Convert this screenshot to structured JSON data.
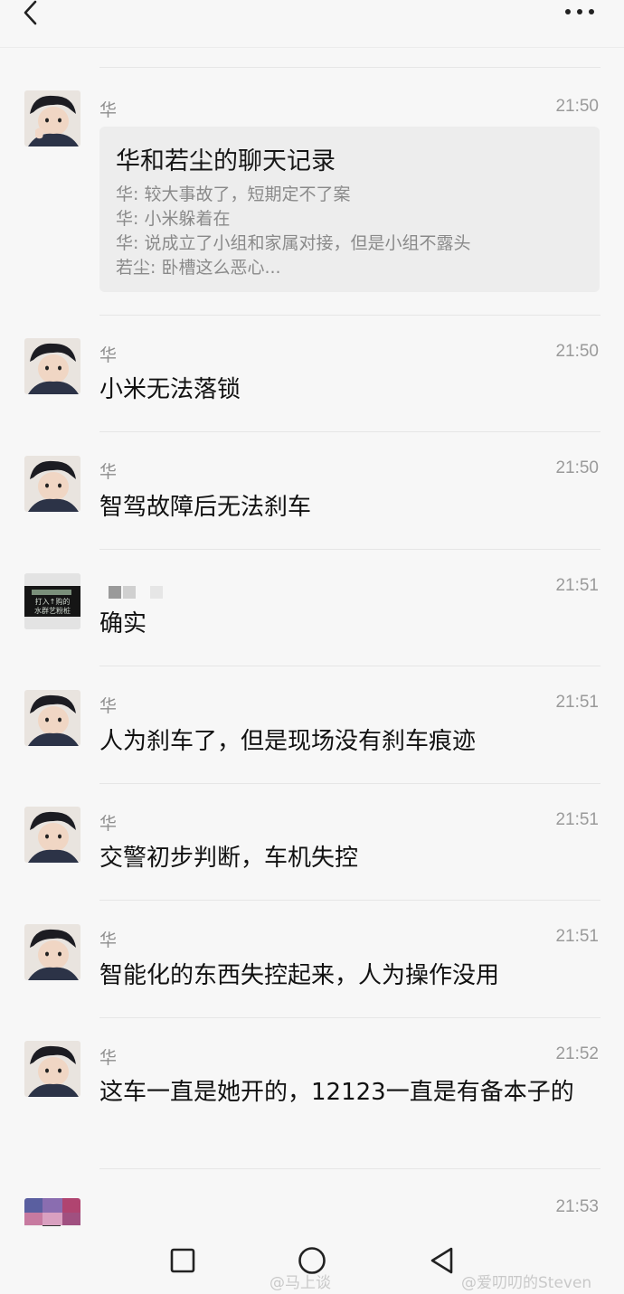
{
  "header": {
    "back": "back-icon",
    "more": "more-icon"
  },
  "card": {
    "sender": "华",
    "time": "21:50",
    "title": "华和若尘的聊天记录",
    "lines": [
      "华: 较大事故了，短期定不了案",
      "华: 小米躲着在",
      "华: 说成立了小组和家属对接，但是小组不露头",
      "若尘: 卧槽这么恶心..."
    ]
  },
  "messages": [
    {
      "sender": "华",
      "time": "21:50",
      "text": "小米无法落锁"
    },
    {
      "sender": "华",
      "time": "21:50",
      "text": "智驾故障后无法刹车"
    },
    {
      "sender": "",
      "time": "21:51",
      "text": "确实"
    },
    {
      "sender": "华",
      "time": "21:51",
      "text": "人为刹车了，但是现场没有刹车痕迹"
    },
    {
      "sender": "华",
      "time": "21:51",
      "text": "交警初步判断，车机失控"
    },
    {
      "sender": "华",
      "time": "21:51",
      "text": "智能化的东西失控起来，人为操作没用"
    },
    {
      "sender": "华",
      "time": "21:52",
      "text": "这车一直是她开的，12123一直是有备本子的"
    },
    {
      "sender": "",
      "time": "21:53",
      "text": ""
    }
  ],
  "other_avatar_text": [
    "打入↑购的",
    "水群艺粉桩"
  ],
  "watermarks": [
    "@马上谈",
    "@爱叨叨的Steven"
  ],
  "colors": {
    "background": "#f7f7f7",
    "card": "#ededed",
    "secondary_text": "#8e8e8e"
  }
}
